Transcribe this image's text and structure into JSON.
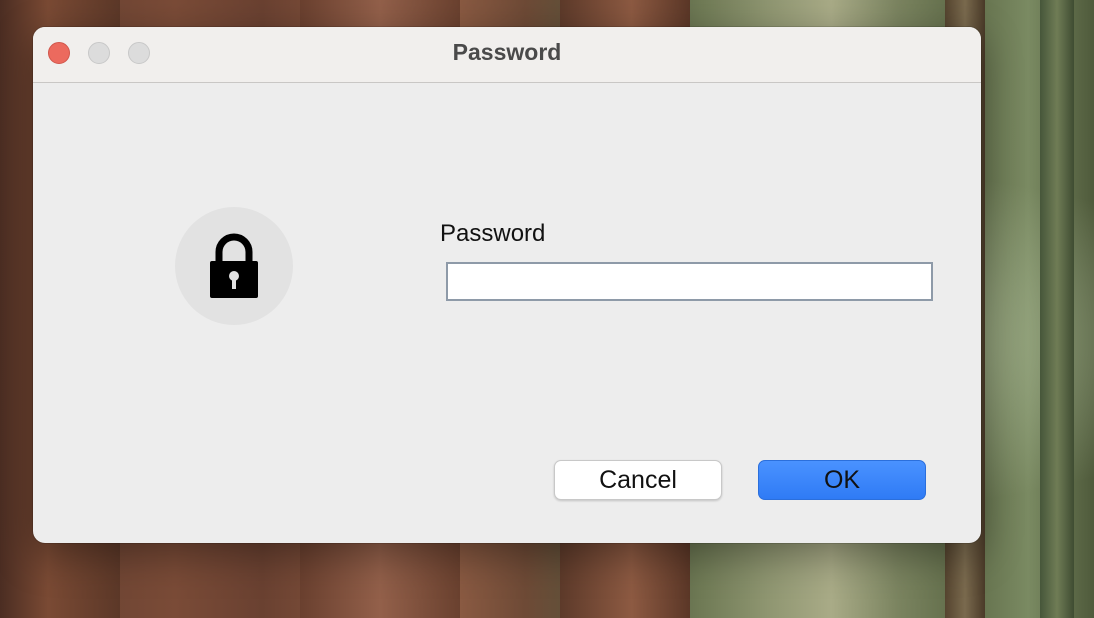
{
  "window": {
    "title": "Password"
  },
  "traffic_lights": {
    "close_color": "#ec6a5e",
    "inactive_color": "#dcdcdc"
  },
  "dialog": {
    "icon": "lock-icon",
    "field_label": "Password",
    "password_value": "",
    "cancel_label": "Cancel",
    "ok_label": "OK"
  },
  "colors": {
    "accent": "#2f7bf5",
    "window_bg": "#ededed"
  }
}
